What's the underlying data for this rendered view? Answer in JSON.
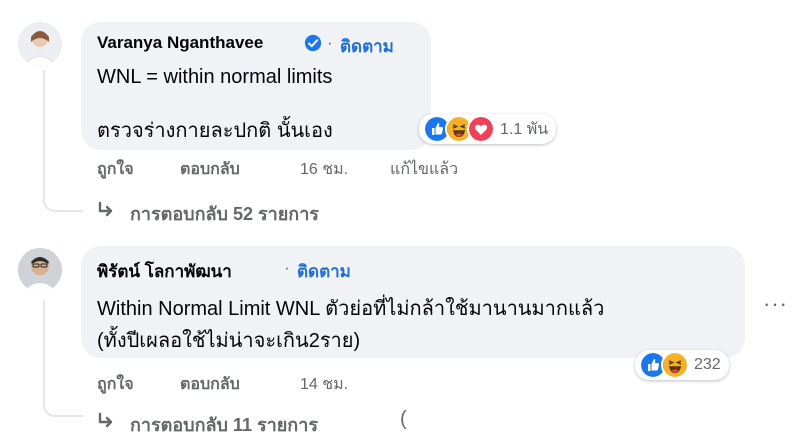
{
  "comments": [
    {
      "author": "Varanya Nganthavee",
      "verified": true,
      "follow_label": "ติดตาม",
      "lines": [
        "WNL = within normal limits",
        "ตรวจร่างกายละปกติ นั้นเอง"
      ],
      "reactions": [
        "like-icon",
        "haha-icon",
        "love-icon"
      ],
      "reaction_count": "1.1 พัน",
      "actions": {
        "like": "ถูกใจ",
        "reply": "ตอบกลับ",
        "time": "16 ชม.",
        "edited": "แก้ไขแล้ว"
      },
      "replies_label": "การตอบกลับ 52 รายการ"
    },
    {
      "author": "พิรัตน์ โลกาพัฒนา",
      "verified": false,
      "follow_label": "ติดตาม",
      "lines": [
        "Within Normal Limit WNL ตัวย่อที่ไม่กล้าใช้มานานมากแล้ว",
        "(ทั้งปีเผลอใช้ไม่น่าจะเกิน2ราย)"
      ],
      "reactions": [
        "like-icon",
        "haha-icon"
      ],
      "reaction_count": "232",
      "actions": {
        "like": "ถูกใจ",
        "reply": "ตอบกลับ",
        "time": "14 ชม."
      },
      "replies_label": "การตอบกลับ 11 รายการ"
    }
  ],
  "colors": {
    "accent": "#216fdb",
    "bubble": "#f0f2f5",
    "secondary_text": "#65676b",
    "like": "#1877f2",
    "love": "#f33e58",
    "haha": "#f7b125"
  }
}
